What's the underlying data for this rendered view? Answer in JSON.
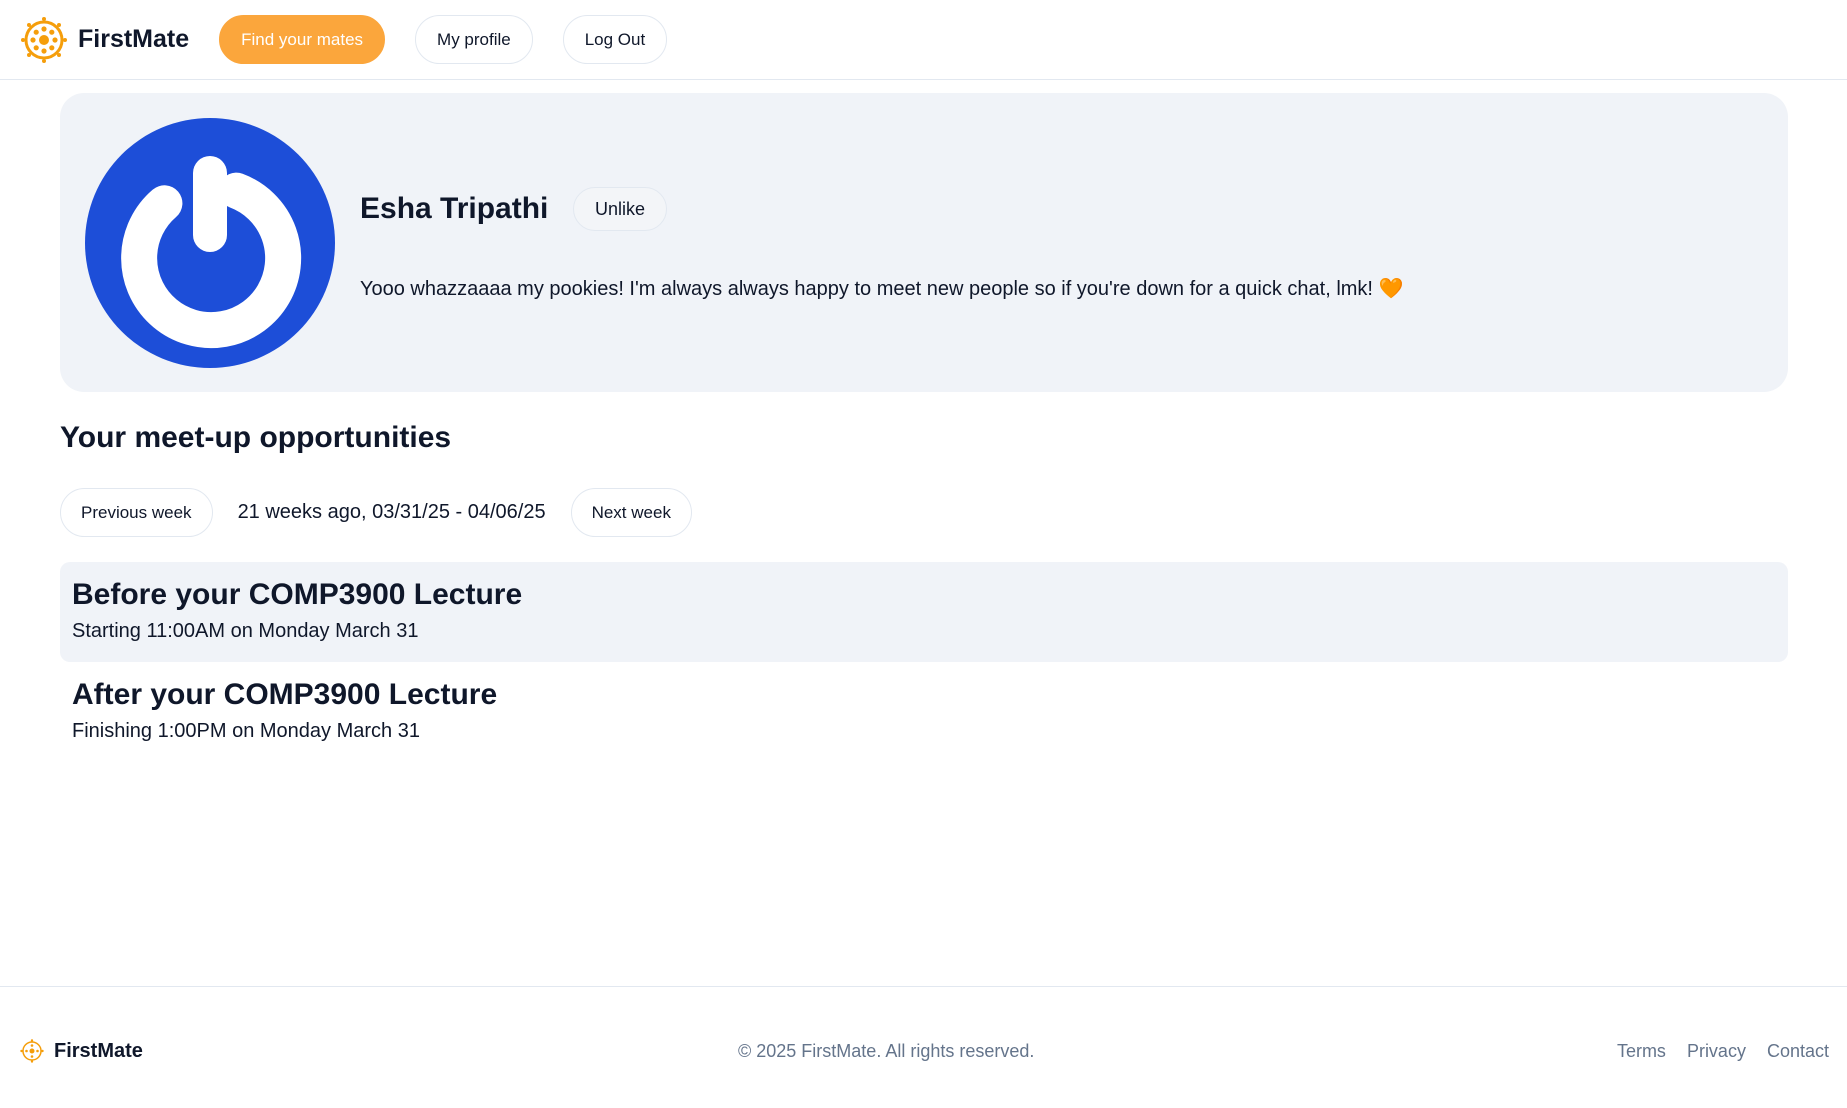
{
  "header": {
    "brand_name": "FirstMate",
    "nav": {
      "find_mates": "Find your mates",
      "my_profile": "My profile",
      "log_out": "Log Out"
    }
  },
  "profile": {
    "name": "Esha Tripathi",
    "unlike_label": "Unlike",
    "bio": "Yooo whazzaaaa my pookies! I'm always always happy to meet new people so if you're down for a quick chat, lmk! 🧡"
  },
  "meetups": {
    "title": "Your meet-up opportunities",
    "previous_week": "Previous week",
    "week_label": "21 weeks ago, 03/31/25 - 04/06/25",
    "next_week": "Next week",
    "items": [
      {
        "title": "Before your COMP3900 Lecture",
        "time": "Starting 11:00AM on Monday March 31"
      },
      {
        "title": "After your COMP3900 Lecture",
        "time": "Finishing 1:00PM on Monday March 31"
      }
    ]
  },
  "footer": {
    "brand_name": "FirstMate",
    "copyright": "© 2025 FirstMate. All rights reserved.",
    "links": [
      "Terms",
      "Privacy",
      "Contact"
    ]
  },
  "colors": {
    "accent": "#fba63c",
    "avatar_bg": "#1d4ed8",
    "card_bg": "#f0f3f8",
    "muted_text": "#64748b"
  },
  "icons": {
    "logo": "sun-wheel-icon",
    "avatar": "power-icon"
  }
}
